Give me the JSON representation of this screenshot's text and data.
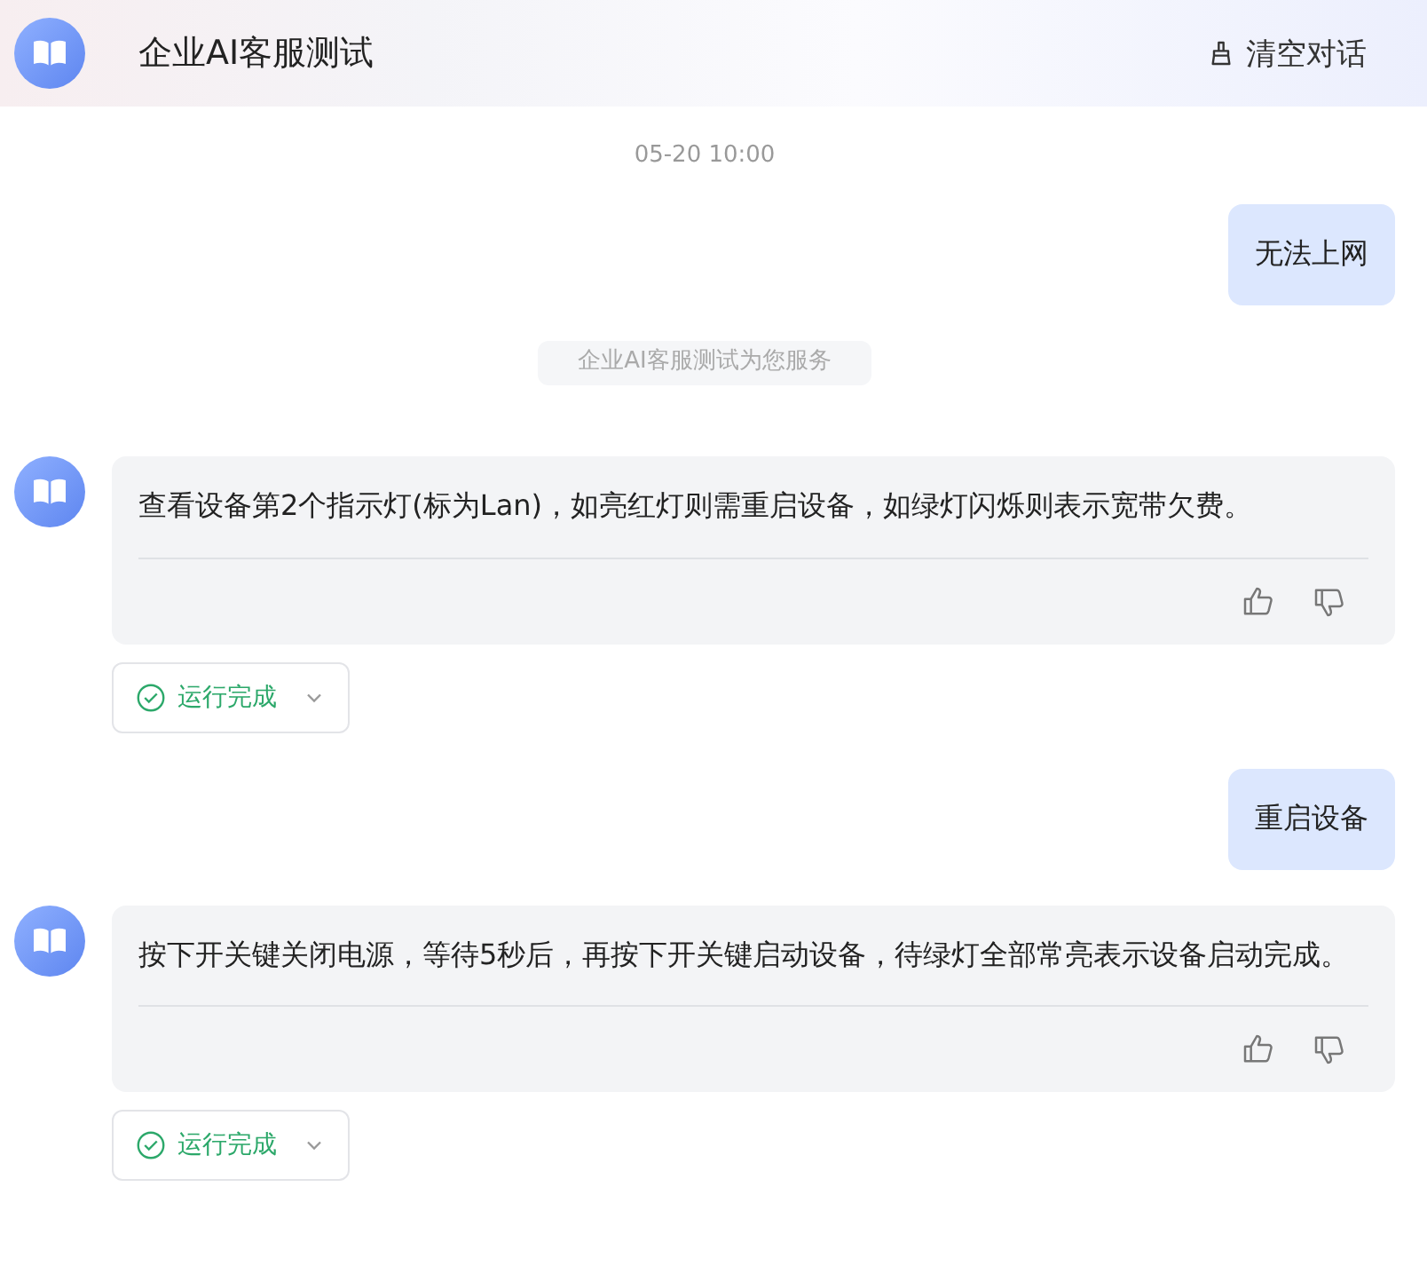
{
  "header": {
    "title": "企业AI客服测试",
    "clear_button": "清空对话"
  },
  "messages": [
    {
      "kind": "time",
      "text": "05-20 10:00"
    },
    {
      "kind": "user",
      "text": "无法上网"
    },
    {
      "kind": "notice",
      "text": "企业AI客服测试为您服务"
    },
    {
      "kind": "bot",
      "text": "查看设备第2个指示灯(标为Lan)，如亮红灯则需重启设备，如绿灯闪烁则表示宽带欠费。",
      "status": "运行完成"
    },
    {
      "kind": "user",
      "text": "重启设备"
    },
    {
      "kind": "bot",
      "text": "按下开关键关闭电源，等待5秒后，再按下开关键启动设备，待绿灯全部常亮表示设备启动完成。",
      "status": "运行完成"
    }
  ]
}
